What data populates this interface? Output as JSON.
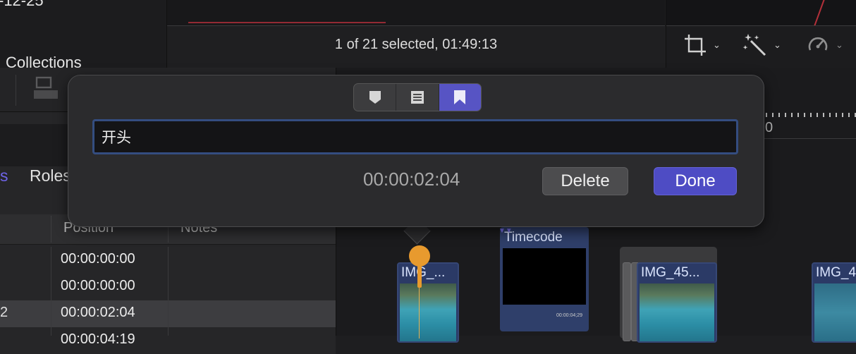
{
  "browser": {
    "date_fragment": "-12-25",
    "collections_label": "Collections"
  },
  "viewer": {
    "selection_status": "1 of 21 selected, 01:49:13"
  },
  "toolbar": {
    "icons": [
      "crop-icon",
      "magic-wand-icon",
      "speedometer-icon"
    ]
  },
  "index": {
    "tabs": [
      "s",
      "Roles"
    ],
    "columns": [
      "Position",
      "Notes"
    ],
    "rows": [
      {
        "left": "",
        "position": "00:00:00:00"
      },
      {
        "left": "",
        "position": "00:00:00:00"
      },
      {
        "left": "2",
        "position": "00:00:02:04"
      },
      {
        "left": "",
        "position": "00:00:04:19"
      }
    ]
  },
  "timeline": {
    "ruler_digit": "0",
    "clips": [
      {
        "label": "IMG_..."
      },
      {
        "label": "Timecode",
        "time": "00:00:04;29"
      },
      {
        "label": "IMG_45..."
      },
      {
        "label": "IMG_4"
      }
    ]
  },
  "marker_popover": {
    "tabs": [
      "standard-marker",
      "todo-marker",
      "chapter-marker"
    ],
    "active_tab": "chapter-marker",
    "name_value": "开头",
    "timecode": "00:00:02:04",
    "delete_label": "Delete",
    "done_label": "Done"
  },
  "colors": {
    "accent": "#5754c4",
    "playhead": "#e89a2e",
    "clip": "#2b3a66"
  }
}
